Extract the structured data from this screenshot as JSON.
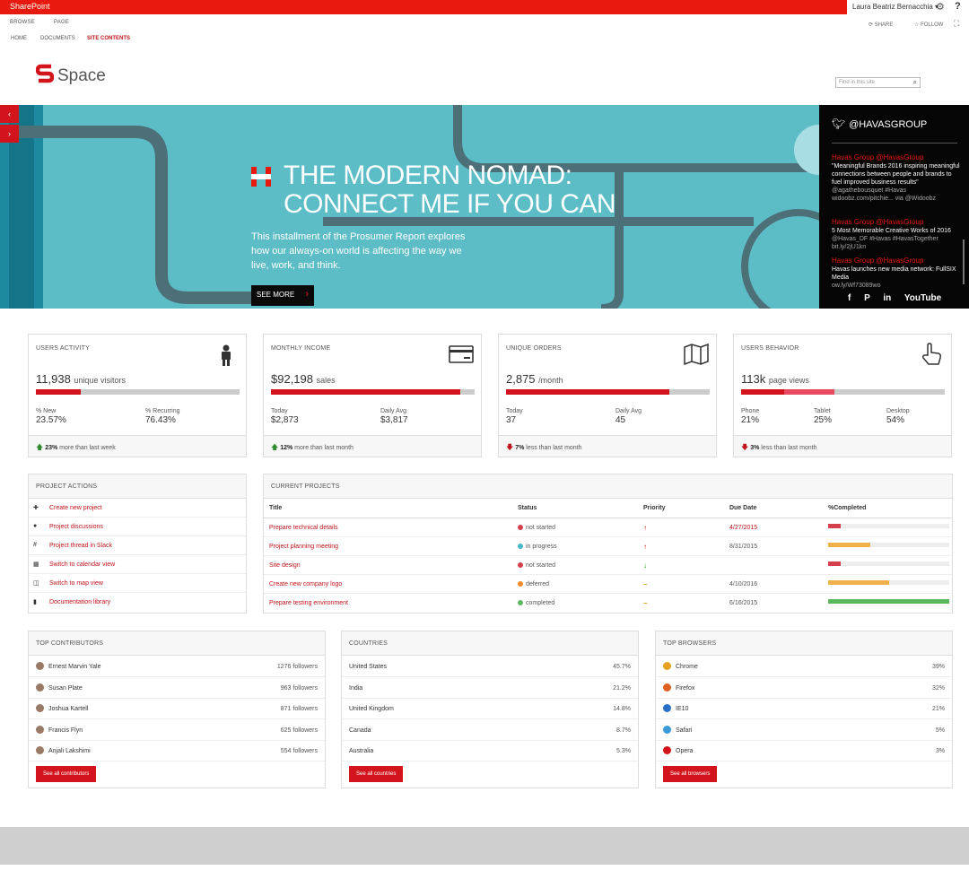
{
  "suite": {
    "brand": "SharePoint",
    "user": "Laura Beatriz Bernacchia ▾",
    "gear": "⚙",
    "help": "?"
  },
  "ribbon": {
    "tabs": [
      "BROWSE",
      "PAGE"
    ],
    "actions": [
      "SHARE",
      "FOLLOW"
    ]
  },
  "nav": [
    "HOME",
    "DOCUMENTS",
    "SITE CONTENTS"
  ],
  "site": {
    "title": "Space",
    "search_placeholder": "Find in this site"
  },
  "hero": {
    "title_line1": "THE MODERN NOMAD:",
    "title_line2": "CONNECT ME IF YOU CAN",
    "text": "This installment of the Prosumer Report explores how our always-on world is affecting the way we live, work, and think.",
    "button": "SEE MORE",
    "prev": "‹",
    "next": "›"
  },
  "twitter": {
    "handle": "@HAVASGROUP",
    "tweets": [
      {
        "who": "Havas Group  @HavasGroup",
        "text": "\"Meaningful Brands 2016 inspiring meaningful connections between people and brands to fuel improved business results\"",
        "meta": "@agathebousquet #Havas widoobz.com/pitchie... via @Widoobz"
      },
      {
        "who": "Havas Group  @HavasGroup",
        "text": "5 Most Memorable Creative Works of 2016",
        "meta": "@Havas_DF #Havas #HavasTogether bit.ly/2jU1kn"
      },
      {
        "who": "Havas Group  @HavasGroup",
        "text": "Havas launches new media network: FullSIX Media",
        "meta": "ow.ly/Wf73089wo"
      }
    ],
    "social": "f  P  in  YouTube"
  },
  "stats": [
    {
      "title": "USERS ACTIVITY",
      "big": "11,938",
      "unit": "unique visitors",
      "fill": 0.22,
      "cols": [
        {
          "l": "% New",
          "v": "23.57%"
        },
        {
          "l": "% Recurring",
          "v": "76.43%"
        }
      ],
      "trend": "up",
      "pct": "23%",
      "foot": "more than last week"
    },
    {
      "title": "MONTHLY INCOME",
      "big": "$92,198",
      "unit": "sales",
      "fill": 0.93,
      "cols": [
        {
          "l": "Today",
          "v": "$2,873"
        },
        {
          "l": "Daily Avg",
          "v": "$3,817"
        }
      ],
      "trend": "up",
      "pct": "12%",
      "foot": "more than last month"
    },
    {
      "title": "UNIQUE ORDERS",
      "big": "2,875",
      "unit": "/month",
      "fill": 0.8,
      "cols": [
        {
          "l": "Today",
          "v": "37"
        },
        {
          "l": "Daily Avg",
          "v": "45"
        }
      ],
      "trend": "down",
      "pct": "7%",
      "foot": "less than last month"
    },
    {
      "title": "USERS BEHAVIOR",
      "big": "113k",
      "unit": "page views",
      "fill": 0.21,
      "cols": [
        {
          "l": "Phone",
          "v": "21%"
        },
        {
          "l": "Tablet",
          "v": "25%"
        },
        {
          "l": "Desktop",
          "v": "54%"
        }
      ],
      "trend": "down",
      "pct": "3%",
      "foot": "less than last month"
    }
  ],
  "actions": {
    "title": "PROJECT ACTIONS",
    "items": [
      {
        "icon": "plus-icon",
        "glyph": "✚",
        "label": "Create new project"
      },
      {
        "icon": "chat-icon",
        "glyph": "●",
        "label": "Project discussions"
      },
      {
        "icon": "slack-icon",
        "glyph": "#",
        "label": "Project thread in Slack"
      },
      {
        "icon": "calendar-icon",
        "glyph": "▦",
        "label": "Switch to calendar view"
      },
      {
        "icon": "map-icon",
        "glyph": "◫",
        "label": "Switch to map view"
      },
      {
        "icon": "book-icon",
        "glyph": "▮",
        "label": "Documentation library"
      }
    ]
  },
  "projects": {
    "title": "CURRENT PROJECTS",
    "headers": [
      "Title",
      "Status",
      "Priority",
      "Due Date",
      "%Completed"
    ],
    "rows": [
      {
        "title": "Prepare technical details",
        "status": "not started",
        "scolor": "#d4404a",
        "priority": "up",
        "due": "4/27/2015",
        "due_red": true,
        "done": 0.1,
        "ccolor": "#d4404a"
      },
      {
        "title": "Project planning meeting",
        "status": "in progress",
        "scolor": "#46b8c8",
        "priority": "up",
        "due": "8/31/2015",
        "due_red": false,
        "done": 0.35,
        "ccolor": "#f0b04a"
      },
      {
        "title": "Site design",
        "status": "not started",
        "scolor": "#d4404a",
        "priority": "down",
        "due": "",
        "due_red": false,
        "done": 0.1,
        "ccolor": "#d4404a"
      },
      {
        "title": "Create new company logo",
        "status": "deferred",
        "scolor": "#f08a2a",
        "priority": "flat",
        "due": "4/10/2016",
        "due_red": false,
        "done": 0.5,
        "ccolor": "#f0b04a"
      },
      {
        "title": "Prepare testing environment",
        "status": "completed",
        "scolor": "#5cb85c",
        "priority": "flat",
        "due": "6/16/2015",
        "due_red": false,
        "done": 1.0,
        "ccolor": "#5cb85c"
      }
    ]
  },
  "contributors": {
    "title": "TOP CONTRIBUTORS",
    "items": [
      {
        "name": "Ernest Marvin Yale",
        "val": "1276 followers"
      },
      {
        "name": "Susan Plate",
        "val": "963 followers"
      },
      {
        "name": "Joshua Kartell",
        "val": "871 followers"
      },
      {
        "name": "Francis Flyn",
        "val": "625 followers"
      },
      {
        "name": "Anjali Lakshimi",
        "val": "554 followers"
      }
    ],
    "button": "See all contributors"
  },
  "countries": {
    "title": "COUNTRIES",
    "items": [
      {
        "name": "United States",
        "val": "45.7%"
      },
      {
        "name": "India",
        "val": "21.2%"
      },
      {
        "name": "United Kingdom",
        "val": "14.8%"
      },
      {
        "name": "Canada",
        "val": "8.7%"
      },
      {
        "name": "Australia",
        "val": "5.3%"
      }
    ],
    "button": "See all countries"
  },
  "browsers": {
    "title": "TOP BROWSERS",
    "items": [
      {
        "name": "Chrome",
        "val": "39%",
        "color": "#e8a020"
      },
      {
        "name": "Firefox",
        "val": "32%",
        "color": "#e06020"
      },
      {
        "name": "IE10",
        "val": "21%",
        "color": "#2a70c8"
      },
      {
        "name": "Safari",
        "val": "5%",
        "color": "#3a9ad8"
      },
      {
        "name": "Opera",
        "val": "3%",
        "color": "#d4141c"
      }
    ],
    "button": "See all browsers"
  },
  "colors": {
    "accent": "#d4141c",
    "suite": "#e8190e",
    "hero": "#5cbdc7"
  }
}
